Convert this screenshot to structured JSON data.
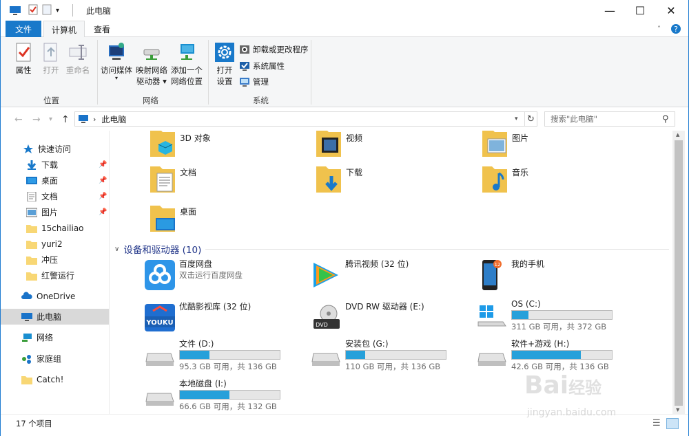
{
  "window": {
    "title": "此电脑",
    "controls": [
      "minimize",
      "maximize",
      "close"
    ]
  },
  "ribbon": {
    "tabs": [
      "文件",
      "计算机",
      "查看"
    ],
    "groups": {
      "location": {
        "label": "位置",
        "buttons": [
          "属性",
          "打开",
          "重命名"
        ]
      },
      "network": {
        "label": "网络",
        "buttons": [
          "访问媒体",
          "映射网络\n驱动器 ▾",
          "添加一个\n网络位置"
        ]
      },
      "system": {
        "label": "系统",
        "open_settings": "打开\n设置",
        "uninstall": "卸载或更改程序",
        "sys_props": "系统属性",
        "manage": "管理"
      }
    }
  },
  "address": {
    "path": "此电脑",
    "search_placeholder": "搜索\"此电脑\""
  },
  "sidebar": {
    "items": [
      {
        "label": "快速访问",
        "icon": "star-icon"
      },
      {
        "label": "下载",
        "icon": "download-icon",
        "pinned": true
      },
      {
        "label": "桌面",
        "icon": "desktop-icon",
        "pinned": true
      },
      {
        "label": "文档",
        "icon": "document-icon",
        "pinned": true
      },
      {
        "label": "图片",
        "icon": "picture-icon",
        "pinned": true
      },
      {
        "label": "15chailiao",
        "icon": "folder-icon"
      },
      {
        "label": "yuri2",
        "icon": "folder-icon"
      },
      {
        "label": "冲压",
        "icon": "folder-icon"
      },
      {
        "label": "红警运行",
        "icon": "folder-icon"
      },
      {
        "label": "OneDrive",
        "icon": "cloud-icon"
      },
      {
        "label": "此电脑",
        "icon": "computer-icon",
        "selected": true
      },
      {
        "label": "网络",
        "icon": "network-icon"
      },
      {
        "label": "家庭组",
        "icon": "homegroup-icon"
      },
      {
        "label": "Catch!",
        "icon": "folder-icon"
      }
    ]
  },
  "folders": [
    "3D 对象",
    "视频",
    "图片",
    "文档",
    "下载",
    "音乐",
    "桌面"
  ],
  "devices": {
    "header": "设备和驱动器 (10)",
    "items": [
      {
        "name": "百度网盘",
        "sub": "双击运行百度网盘",
        "icon": "baidu-netdisk-icon"
      },
      {
        "name": "腾讯视频 (32 位)",
        "sub": "",
        "icon": "tencent-video-icon"
      },
      {
        "name": "我的手机",
        "sub": "",
        "icon": "phone-icon"
      },
      {
        "name": "优酷影视库 (32 位)",
        "sub": "",
        "icon": "youku-icon"
      },
      {
        "name": "DVD RW 驱动器 (E:)",
        "sub": "",
        "icon": "dvd-drive-icon"
      },
      {
        "name": "OS (C:)",
        "sub": "311 GB 可用，共 372 GB",
        "icon": "windows-drive-icon",
        "used": 0.164
      },
      {
        "name": "文件 (D:)",
        "sub": "95.3 GB 可用，共 136 GB",
        "icon": "drive-icon",
        "used": 0.299
      },
      {
        "name": "安装包 (G:)",
        "sub": "110 GB 可用，共 136 GB",
        "icon": "drive-icon",
        "used": 0.191
      },
      {
        "name": "软件+游戏 (H:)",
        "sub": "42.6 GB 可用，共 136 GB",
        "icon": "drive-icon",
        "used": 0.687
      },
      {
        "name": "本地磁盘 (I:)",
        "sub": "66.6 GB 可用，共 132 GB",
        "icon": "drive-icon",
        "used": 0.495
      }
    ]
  },
  "status": {
    "count": "17 个项目"
  },
  "watermark": {
    "text": "Bai 经验",
    "url": "jingyan.baidu.com"
  },
  "colors": {
    "accent": "#1979ca",
    "drive_bar": "#26a0da",
    "section_header": "#1e3287"
  }
}
